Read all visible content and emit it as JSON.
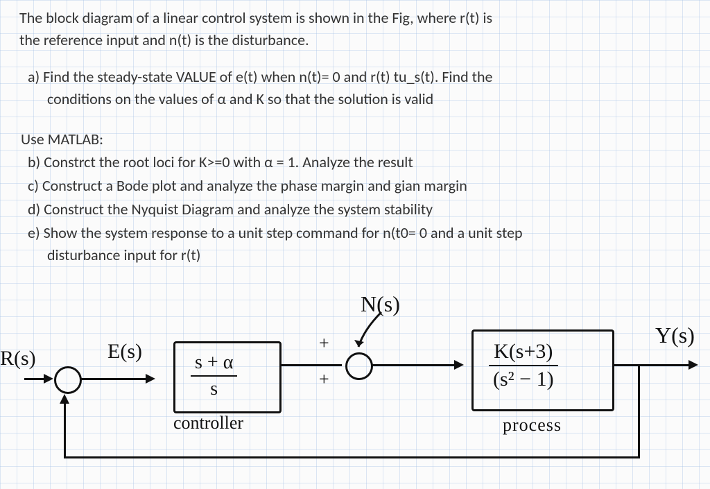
{
  "problem": {
    "intro": "The block diagram of a linear control system is shown in the Fig, where r(t) is the reference input and n(t) is the disturbance.",
    "a": "a)  Find the steady-state VALUE of e(t) when n(t)= 0 and r(t) tu_s(t). Find the conditions on the values of α and K so that the solution is valid",
    "use_matlab": "Use MATLAB:",
    "b": "b)  Constrct the root loci for K>=0 with  α = 1. Analyze the result",
    "c": "c)  Construct a Bode plot and analyze the phase margin and gian margin",
    "d": "d)  Construct the Nyquist Diagram and analyze the system stability",
    "e": "e)  Show the system response to a unit step command for n(t0= 0 and a unit step disturbance input for r(t)"
  },
  "diagram": {
    "signals": {
      "r": "R(s)",
      "e": "E(s)",
      "n": "N(s)",
      "y": "Y(s)"
    },
    "blocks": {
      "controller": {
        "num": "s + α",
        "den": "s",
        "label": "controller"
      },
      "process": {
        "num": "K(s+3)",
        "den": "(s² − 1)",
        "label": "process"
      }
    },
    "sum2": {
      "plus_top": "+",
      "plus_bottom": "+"
    }
  }
}
